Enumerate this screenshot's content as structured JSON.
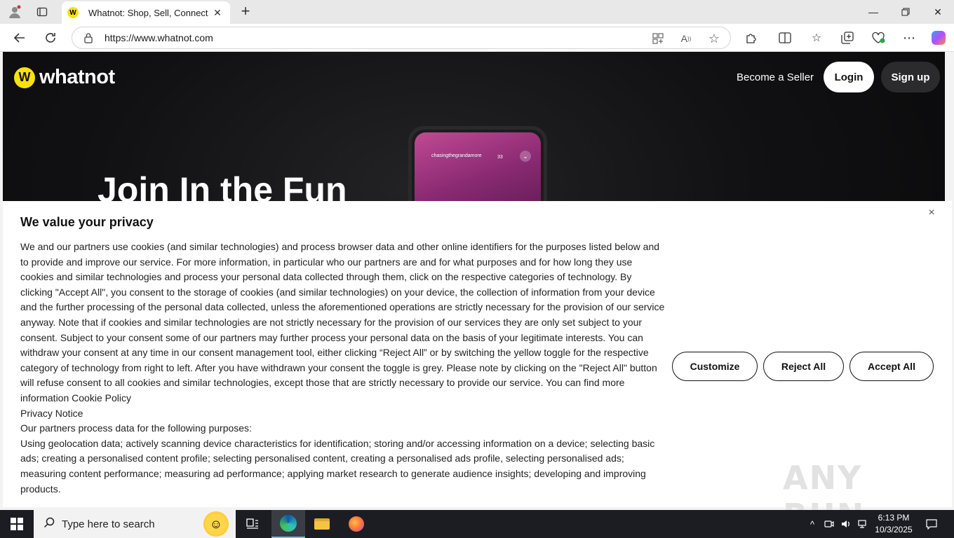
{
  "browser": {
    "tab_title": "Whatnot: Shop, Sell, Connect",
    "favicon_letter": "W",
    "url": "https://www.whatnot.com"
  },
  "site": {
    "logo_text": "whatnot",
    "nav": {
      "become_seller": "Become a Seller",
      "login": "Login",
      "signup": "Sign up"
    },
    "hero_title": "Join In the Fun",
    "phone_mockup": {
      "username": "chasingthegrandamore",
      "viewers": "33"
    }
  },
  "cookie_banner": {
    "title": "We value your privacy",
    "body_paragraph": "We and our partners use cookies (and similar technologies) and process browser data and other online identifiers for the purposes listed below and to provide and improve our service. For more information, in particular who our partners are and for what purposes and for how long they use cookies and similar technologies and process your personal data collected through them, click on the respective categories of technology. By clicking \"Accept All\", you consent to the storage of cookies (and similar technologies) on your device, the collection of information from your device and the further processing of the personal data collected, unless the aforementioned operations are strictly necessary for the provision of our service anyway. Note that if cookies and similar technologies are not strictly necessary for the provision of our services they are only set subject to your consent. Subject to your consent some of our partners may further process your personal data on the basis of your legitimate interests. You can withdraw your consent at any time in our consent management tool, either clicking “Reject All” or by switching the yellow toggle for the respective category of technology from right to left. After you have withdrawn your consent the toggle is grey. Please note by clicking on the \"Reject All\" button will refuse consent to all cookies and similar technologies, except those that are strictly necessary to provide our service. You can find more information Cookie Policy",
    "privacy_notice": "Privacy Notice",
    "partners_heading": "Our partners process data for the following purposes:",
    "purposes": "Using geolocation data; actively scanning device characteristics for identification; storing and/or accessing information on a device; selecting basic ads; creating a personalised content profile; selecting personalised content, creating a personalised ads profile, selecting personalised ads; measuring content performance; measuring ad performance; applying market research to generate audience insights; developing and improving products.",
    "buttons": {
      "customize": "Customize",
      "reject_all": "Reject All",
      "accept_all": "Accept All"
    },
    "close_glyph": "×"
  },
  "watermark": "ANY RUN",
  "taskbar": {
    "search_placeholder": "Type here to search",
    "time": "6:13 PM",
    "date": "10/3/2025"
  },
  "colors": {
    "brand_yellow": "#f8e10f",
    "page_bg": "#0b0b0c",
    "taskbar_bg": "#1b1d22"
  }
}
